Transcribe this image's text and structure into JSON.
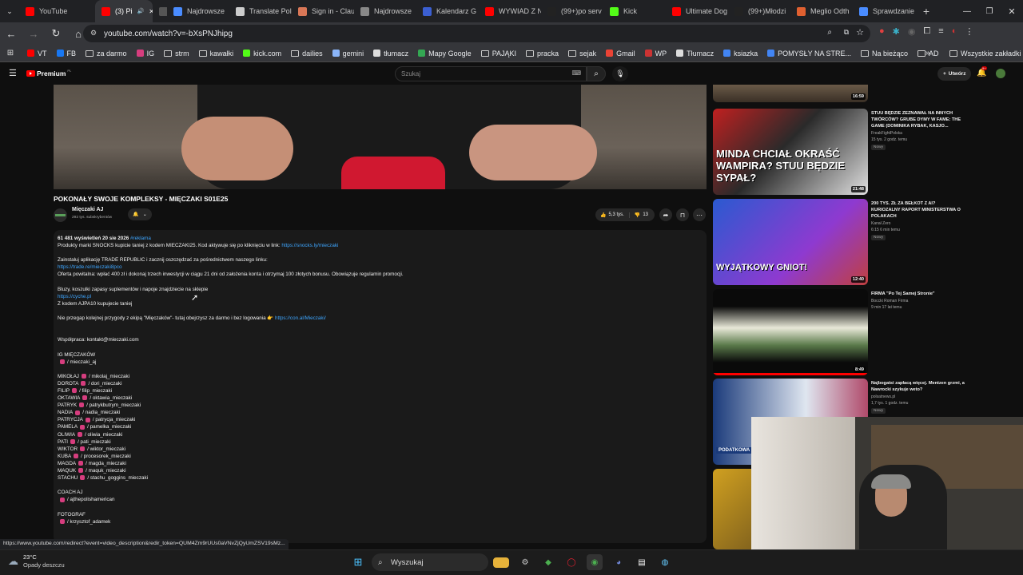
{
  "tabs": [
    {
      "label": "YouTube",
      "color": "#ff0000"
    },
    {
      "label": "(3) Pi",
      "color": "#ff0000",
      "active": true
    },
    {
      "label": "",
      "color": "#555555"
    },
    {
      "label": "Najdrowsze",
      "color": "#4a8cff"
    },
    {
      "label": "Translate Pol",
      "color": "#cccccc"
    },
    {
      "label": "Sign in - Clau",
      "color": "#d97757"
    },
    {
      "label": "Najdrowsze",
      "color": "#888888"
    },
    {
      "label": "Kalendarz G",
      "color": "#3b5fd1"
    },
    {
      "label": "WYWIAD Z N",
      "color": "#ff0000"
    },
    {
      "label": "(99+)po serv",
      "color": "#222222"
    },
    {
      "label": "Kick",
      "color": "#53fc18"
    },
    {
      "label": "Ultimate Dog",
      "color": "#ff0000"
    },
    {
      "label": "(99+)Młodzi",
      "color": "#222222"
    },
    {
      "label": "Meglio Odth",
      "color": "#e06030"
    },
    {
      "label": "Sprawdzanie",
      "color": "#4a8cff"
    }
  ],
  "toolbar": {
    "url": "youtube.com/watch?v=-bXsPNJhipg"
  },
  "bookmarks": [
    {
      "label": "VT",
      "icon": "youtube-icon"
    },
    {
      "label": "FB",
      "icon": "facebook-icon"
    },
    {
      "label": "za darmo",
      "icon": "folder-icon"
    },
    {
      "label": "IG",
      "icon": "instagram-icon"
    },
    {
      "label": "strm",
      "icon": "folder-icon"
    },
    {
      "label": "kawałki",
      "icon": "folder-icon"
    },
    {
      "label": "kick.com",
      "icon": "kick-icon"
    },
    {
      "label": "dailies",
      "icon": "folder-icon"
    },
    {
      "label": "gemini",
      "icon": "gemini-icon"
    },
    {
      "label": "tłumacz",
      "icon": "translate-icon"
    },
    {
      "label": "Mapy Google",
      "icon": "maps-icon"
    },
    {
      "label": "PAJĄKI",
      "icon": "folder-icon"
    },
    {
      "label": "pracka",
      "icon": "folder-icon"
    },
    {
      "label": "sejak",
      "icon": "folder-icon"
    },
    {
      "label": "Gmail",
      "icon": "gmail-icon"
    },
    {
      "label": "WP",
      "icon": "wp-icon"
    },
    {
      "label": "Tłumacz",
      "icon": "translate-icon"
    },
    {
      "label": "ksiazka",
      "icon": "grid-icon"
    },
    {
      "label": "POMYSŁY NA STRE...",
      "icon": "grid-icon"
    },
    {
      "label": "Na bieżąco",
      "icon": "folder-icon"
    },
    {
      "label": "AD",
      "icon": "folder-icon"
    }
  ],
  "bookmarks_all": "Wszystkie zakładki",
  "youtube": {
    "logo": "Premium",
    "logo_sup": "PL",
    "search_placeholder": "Szukaj",
    "create_label": "Utwórz",
    "notif_count": "9+"
  },
  "video": {
    "title": "POKONAŁY SWOJE KOMPLEKSY - MIĘCZAKI S01E25",
    "channel": "Mięczaki AJ",
    "subscribers": "292 tys. subskrybentów",
    "likes": "5,3 tys.",
    "dislikes": "13"
  },
  "description": [
    {
      "t": "61 481 wyświetleń  20 sie 2026  ",
      "tag": "#reklama",
      "bold": true
    },
    {
      "t": "Produkty marki SNOCKS kupicie taniej z kodem MIECZAKI25. Kod aktywuje się po kliknięciu w link: ",
      "link": "https://snocks.ly/mieczaki"
    },
    {
      "t": ""
    },
    {
      "t": "Zainstaluj aplikację TRADE REPUBLIC i zacznij oszczędzać za pośrednictwem naszego linku:"
    },
    {
      "t": "",
      "link": "https://trade.re/mieczaki8pco"
    },
    {
      "t": "Oferta powitalna: wpłać 400 zł i dokonaj trzech inwestycji w ciągu 21 dni od założenia konta i otrzymaj 100 złotych bonusu. Obowiązuje regulamin promocji."
    },
    {
      "t": ""
    },
    {
      "t": "Bluzy, koszulki zapasy suplementów i napoje znajdziecie na sklepie"
    },
    {
      "t": "",
      "link": "https://cyche.pl"
    },
    {
      "t": "Z kodem AJPA10 kupujecie taniej"
    },
    {
      "t": ""
    },
    {
      "t": "Nie przegap kolejnej przygody z ekipą \"Mięczaków\"- tutaj obejrzysz za darmo i bez logowania 👉 ",
      "link": "https://con.al/Mieczaki/"
    },
    {
      "t": ""
    },
    {
      "t": ""
    },
    {
      "t": "Współpraca: kontakt@mieczaki.com"
    },
    {
      "t": ""
    },
    {
      "t": "IG MIĘCZAKÓW"
    },
    {
      "ig": "/ mieczaki_aj"
    },
    {
      "t": ""
    },
    {
      "t": "MIKOŁAJ",
      "ig": "/ mikolaj_mieczaki"
    },
    {
      "t": "DOROTA",
      "ig": "/ dori_mieczaki"
    },
    {
      "t": "FILIP",
      "ig": "/ filip_mieczaki"
    },
    {
      "t": "OKTAWIA",
      "ig": "/ oktawia_mieczaki"
    },
    {
      "t": "PATRYK",
      "ig": "/ patrykbutrym_mieczaki"
    },
    {
      "t": "NADIA",
      "ig": "/ nadia_mieczaki"
    },
    {
      "t": "PATRYCJA",
      "ig": "/ patrycja_mieczaki"
    },
    {
      "t": "PAMELA",
      "ig": "/ pamelka_mieczaki"
    },
    {
      "t": "OLIWIA",
      "ig": "/ oliwia_mieczaki"
    },
    {
      "t": "PATI",
      "ig": "/ pati_mieczaki"
    },
    {
      "t": "WIKTOR",
      "ig": "/ wiktor_mieczaki"
    },
    {
      "t": "KUBA",
      "ig": "/ procesorek_mieczaki"
    },
    {
      "t": "MAGDA",
      "ig": "/ magda_mieczaki"
    },
    {
      "t": "MAQUK",
      "ig": "/ maquk_mieczaki"
    },
    {
      "t": "STACHU",
      "ig": "/ stachu_goggins_mieczaki"
    },
    {
      "t": ""
    },
    {
      "t": "COACH AJ"
    },
    {
      "ig": "/ ajthepolishamerican"
    },
    {
      "t": ""
    },
    {
      "t": "FOTOGRAF"
    },
    {
      "ig": "/ krzysztof_adamek"
    }
  ],
  "sidebar": [
    {
      "title": "",
      "channel": "",
      "meta": "",
      "duration": "16:59",
      "badge": ""
    },
    {
      "title": "STUU BĘDZIE ZEZNAWAŁ NA INNYCH TWÓRCÓW? GRUBE DYMY W FAME: THE GAME (DOMINIKA RYBAK, KASJO...",
      "channel": "FreakFightPolska",
      "meta": "15 tys.  2 godz. temu",
      "duration": "21:48",
      "badge": "Nowy",
      "overlay": "MINDA CHCIAŁ OKRAŚĆ WAMPIRA? STUU BĘDZIE SYPAŁ?"
    },
    {
      "title": "200 TYS. ZŁ ZA BEŁKOT Z AI? KURIOZALNY RAPORT MINISTERSTWA O POLAKACH",
      "channel": "Kanał Zero",
      "meta": "6:15  6 min temu",
      "duration": "12:40",
      "badge": "Nowy",
      "overlay": "WYJĄTKOWY GNIOT!"
    },
    {
      "title": "FIRMA \"Po Tej Samej Stronie\"",
      "channel": "Boccki Roman Firma",
      "meta": "9 min  17 lat temu",
      "duration": "8:49",
      "badge": ""
    },
    {
      "title": "Najbogatsi zapłacą więcej. Mentzen grzmi, a Nawrocki szykuje weto?",
      "channel": "polsatnews.pl",
      "meta": "1,7 tys.  1 godz. temu",
      "duration": "",
      "badge": "Nowy",
      "overlay": "PODATKOWA"
    }
  ],
  "statusbar": "https://www.youtube.com/redirect?event=video_description&redir_token=QUM4Zm9rUUs0aVNvZjQyUmZSV19sMz...",
  "weather": {
    "temp": "23°C",
    "desc": "Opady deszczu"
  },
  "taskbar_search": "Wyszukaj",
  "colors": {
    "yt_red": "#ff0000",
    "link": "#3ea6ff",
    "ig": "#d63d7e",
    "bg": "#0f0f0f"
  }
}
